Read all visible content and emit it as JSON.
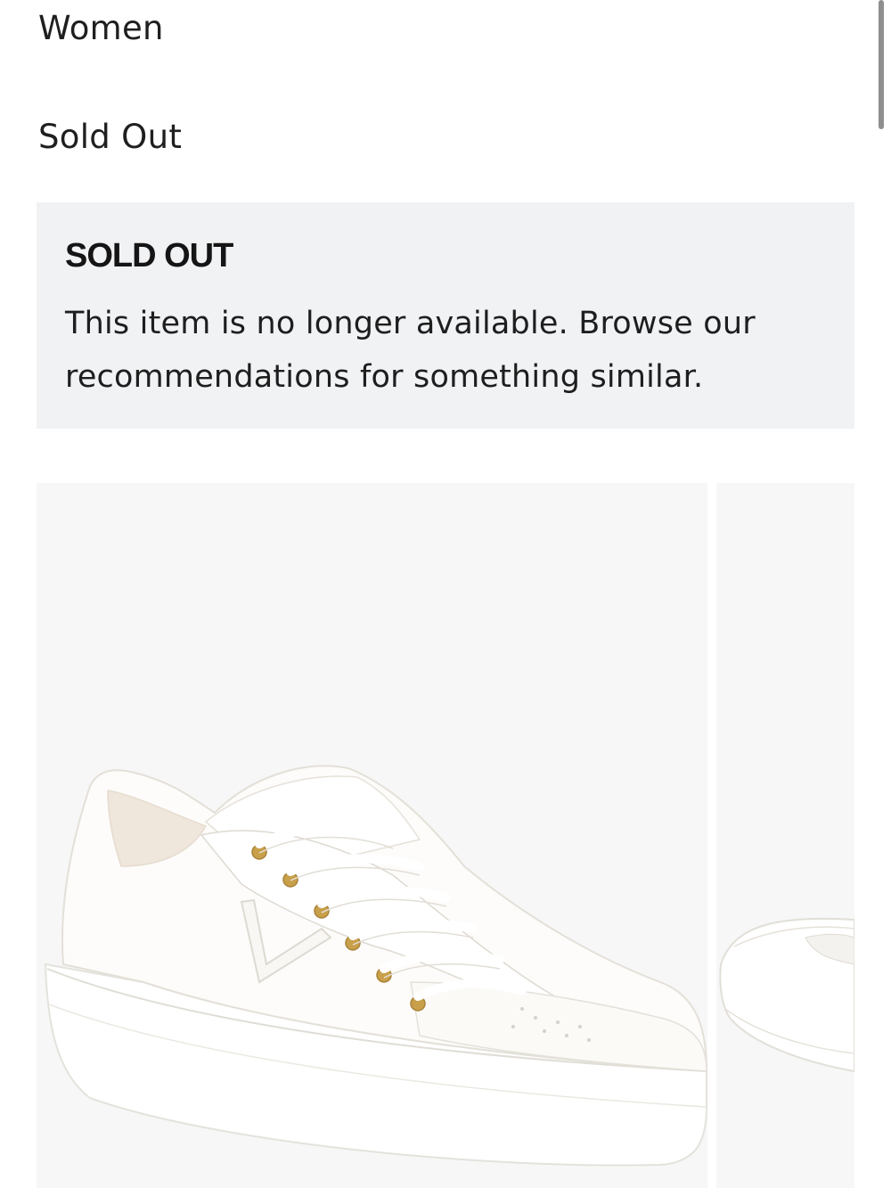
{
  "product": {
    "category": "Women",
    "availability": "Sold Out"
  },
  "notice": {
    "heading": "SOLD OUT",
    "message": "This item is no longer available. Browse our recommendations for something similar."
  },
  "gallery": {
    "images": [
      {
        "icon": "white-leather-sneaker-image"
      },
      {
        "icon": "white-leather-sneaker-image"
      }
    ]
  },
  "colors": {
    "notice_bg": "#f1f2f4",
    "image_bg": "#f7f7f7",
    "eyelet_gold": "#c9a04a"
  }
}
